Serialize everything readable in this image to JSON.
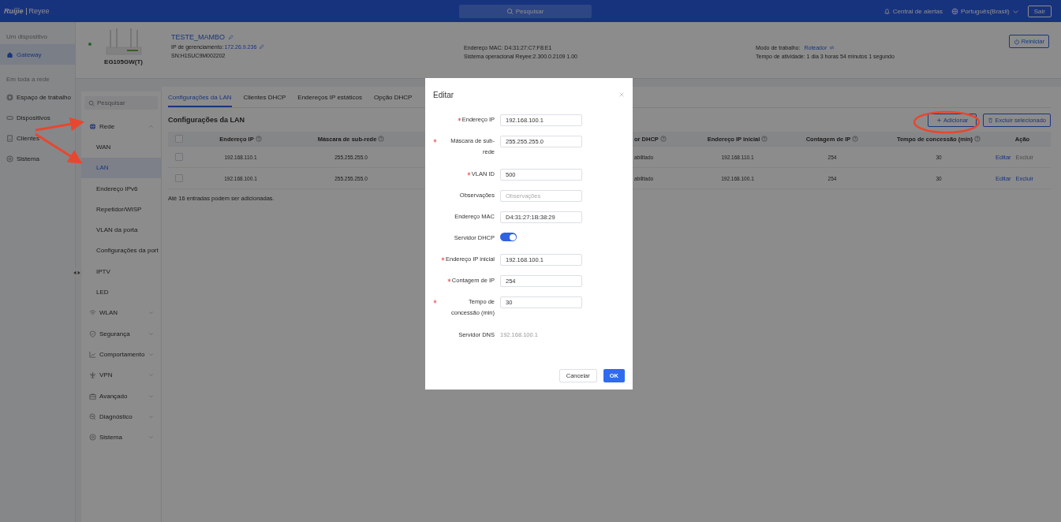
{
  "topbar": {
    "logo_brand": "Ruijie",
    "logo_product": "Reyee",
    "search": "Pesquisar",
    "alerts": "Central de alertas",
    "language": "Português(Brasil)",
    "logout": "Sair"
  },
  "main_nav": [
    {
      "heading": "Um dispositivo",
      "items": [
        {
          "label": "Gateway",
          "selected": true
        }
      ]
    },
    {
      "heading": "Em toda a rede",
      "items": [
        {
          "label": "Espaço de trabalho",
          "selected": false
        },
        {
          "label": "Dispositivos",
          "selected": false
        },
        {
          "label": "Clientes",
          "selected": false
        },
        {
          "label": "Sistema",
          "selected": false
        }
      ]
    }
  ],
  "device": {
    "online": true,
    "model": "EG105GW(T)",
    "name": "TESTE_MAMBO",
    "ip_label": "IP de gerenciamento:",
    "ip": "172.26.9.236",
    "sn": "SN:H1SUC9M002202",
    "mac": "Endereço MAC: D4:31:27:C7:F8:E1",
    "os": "Sistema operacional Reyee:2.300.0.2109 1.00",
    "mode_label": "Modo de trabalho:",
    "mode": "Roteador",
    "uptime": "Tempo de atividade: 1 dia 3 horas 54 minutos 1 segundo",
    "restart": "Reiniciar"
  },
  "menu": {
    "search_placeholder": "Pesquisar",
    "items": [
      {
        "label": "Rede",
        "expanded": true,
        "children": [
          {
            "label": "WAN",
            "selected": false
          },
          {
            "label": "LAN",
            "selected": true
          },
          {
            "label": "Endereço IPv6",
            "selected": false
          },
          {
            "label": "Repetidor/WISP",
            "selected": false
          },
          {
            "label": "VLAN da porta",
            "selected": false
          },
          {
            "label": "Configurações da port",
            "selected": false
          },
          {
            "label": "IPTV",
            "selected": false
          },
          {
            "label": "LED",
            "selected": false
          }
        ]
      },
      {
        "label": "WLAN",
        "expanded": false
      },
      {
        "label": "Segurança",
        "expanded": false
      },
      {
        "label": "Comportamento",
        "expanded": false
      },
      {
        "label": "VPN",
        "expanded": false
      },
      {
        "label": "Avançado",
        "expanded": false
      },
      {
        "label": "Diagnóstico",
        "expanded": false
      },
      {
        "label": "Sistema",
        "expanded": false
      }
    ]
  },
  "tabs": [
    {
      "label": "Configurações da LAN",
      "selected": true
    },
    {
      "label": "Clientes DHCP",
      "selected": false
    },
    {
      "label": "Endereços IP estáticos",
      "selected": false
    },
    {
      "label": "Opção DHCP",
      "selected": false
    }
  ],
  "section_title": "Configurações da LAN",
  "actions": {
    "add": "Adicionar",
    "delete_selected": "Excluir selecionado"
  },
  "table": {
    "all_checked": false,
    "columns": [
      "Endereço IP",
      "Máscara de sub-rede",
      "or DHCP",
      "Endereço IP inicial",
      "Contagem de IP",
      "Tempo de concessão (min)",
      "Ação"
    ],
    "rows": [
      {
        "checked": false,
        "cells": [
          "192.168.110.1",
          "255.255.255.0",
          "abilitado",
          "192.168.110.1",
          "254",
          "30"
        ],
        "actions": [
          {
            "label": "Editar",
            "disabled": false
          },
          {
            "label": "Excluir",
            "disabled": true
          }
        ]
      },
      {
        "checked": false,
        "cells": [
          "192.168.100.1",
          "255.255.255.0",
          "abilitado",
          "192.168.100.1",
          "254",
          "30"
        ],
        "actions": [
          {
            "label": "Editar",
            "disabled": false
          },
          {
            "label": "Excluir",
            "disabled": false
          }
        ]
      }
    ]
  },
  "footnote": "Até 16 entradas podem ser adicionadas.",
  "dialog": {
    "title": "Editar",
    "fields": [
      {
        "kind": "input",
        "label": "Endereço IP",
        "required": true,
        "value": "192.168.100.1"
      },
      {
        "kind": "input",
        "label": "Máscara de sub-rede",
        "required": true,
        "value": "255.255.255.0"
      },
      {
        "kind": "input",
        "label": "VLAN ID",
        "required": true,
        "value": "500"
      },
      {
        "kind": "input",
        "label": "Observações",
        "required": false,
        "placeholder": "Observações"
      },
      {
        "kind": "input",
        "label": "Endereço MAC",
        "required": false,
        "value": "D4:31:27:1B:38:29"
      },
      {
        "kind": "switch",
        "label": "Servidor DHCP",
        "required": false,
        "on": true
      },
      {
        "kind": "input",
        "label": "Endereço IP inicial",
        "required": true,
        "value": "192.168.100.1"
      },
      {
        "kind": "input",
        "label": "Contagem de IP",
        "required": true,
        "value": "254"
      },
      {
        "kind": "input",
        "label": "Tempo de concessão (min)",
        "required": true,
        "value": "30"
      },
      {
        "kind": "text",
        "label": "Servidor DNS",
        "required": false,
        "value": "192.168.100.1"
      }
    ],
    "cancel": "Cancelar",
    "ok": "OK"
  }
}
